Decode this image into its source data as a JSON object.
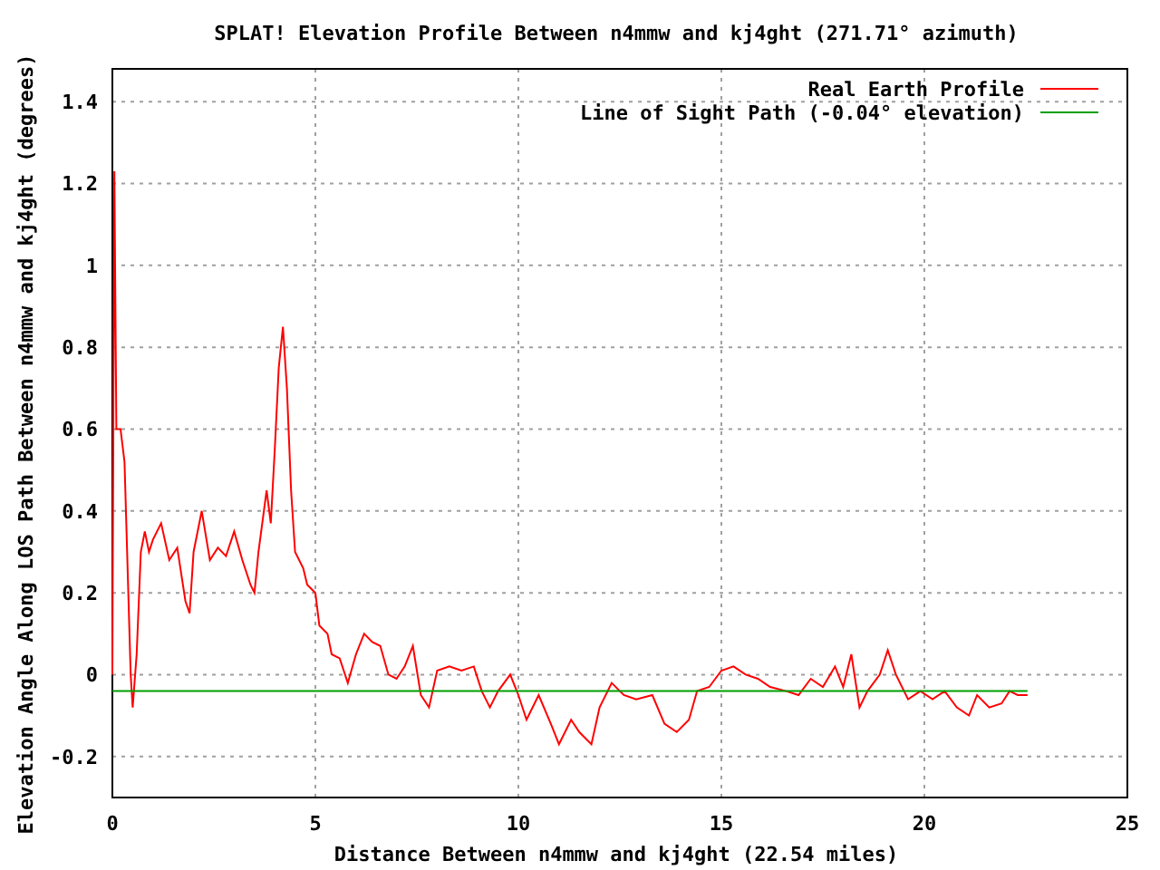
{
  "chart": {
    "chart_data": {
      "type": "line",
      "title": "SPLAT! Elevation Profile Between n4mmw and kj4ght (271.71° azimuth)",
      "xlabel": "Distance Between n4mmw and kj4ght (22.54 miles)",
      "ylabel": "Elevation Angle Along LOS Path Between n4mmw and kj4ght (degrees)",
      "xlim": [
        0,
        25
      ],
      "ylim": [
        -0.3,
        1.48
      ],
      "grid": true,
      "legend": "upper right",
      "xticks": [
        0,
        5,
        10,
        15,
        20,
        25
      ],
      "yticks": [
        -0.2,
        0,
        0.2,
        0.4,
        0.6,
        0.8,
        1,
        1.2,
        1.4
      ],
      "x": [
        0,
        0.05,
        0.1,
        0.2,
        0.3,
        0.45,
        0.5,
        0.6,
        0.7,
        0.8,
        0.9,
        1.0,
        1.2,
        1.4,
        1.6,
        1.8,
        1.9,
        2.0,
        2.2,
        2.4,
        2.6,
        2.8,
        3.0,
        3.2,
        3.4,
        3.5,
        3.6,
        3.8,
        3.9,
        4.0,
        4.1,
        4.2,
        4.3,
        4.4,
        4.5,
        4.7,
        4.8,
        5.0,
        5.1,
        5.3,
        5.4,
        5.6,
        5.8,
        6.0,
        6.2,
        6.4,
        6.6,
        6.8,
        7.0,
        7.2,
        7.4,
        7.6,
        7.8,
        8.0,
        8.3,
        8.6,
        8.9,
        9.1,
        9.3,
        9.5,
        9.8,
        10.0,
        10.2,
        10.5,
        10.8,
        11.0,
        11.3,
        11.5,
        11.8,
        12.0,
        12.3,
        12.6,
        12.9,
        13.3,
        13.6,
        13.9,
        14.2,
        14.4,
        14.7,
        15.0,
        15.3,
        15.6,
        15.9,
        16.2,
        16.6,
        16.9,
        17.2,
        17.5,
        17.8,
        18.0,
        18.2,
        18.4,
        18.6,
        18.9,
        19.1,
        19.3,
        19.6,
        19.9,
        20.2,
        20.5,
        20.8,
        21.1,
        21.3,
        21.6,
        21.9,
        22.1,
        22.3,
        22.54
      ],
      "series": [
        {
          "name": "Real Earth Profile",
          "color": "#ff0000",
          "values": [
            0,
            1.23,
            0.6,
            0.6,
            0.52,
            0.0,
            -0.08,
            0.05,
            0.3,
            0.35,
            0.3,
            0.33,
            0.37,
            0.28,
            0.31,
            0.18,
            0.15,
            0.3,
            0.4,
            0.28,
            0.31,
            0.29,
            0.35,
            0.28,
            0.22,
            0.2,
            0.3,
            0.45,
            0.37,
            0.55,
            0.75,
            0.85,
            0.7,
            0.45,
            0.3,
            0.26,
            0.22,
            0.2,
            0.12,
            0.1,
            0.05,
            0.04,
            -0.02,
            0.05,
            0.1,
            0.08,
            0.07,
            0.0,
            -0.01,
            0.02,
            0.07,
            -0.05,
            -0.08,
            0.01,
            0.02,
            0.01,
            0.02,
            -0.04,
            -0.08,
            -0.04,
            0.0,
            -0.05,
            -0.11,
            -0.05,
            -0.12,
            -0.17,
            -0.11,
            -0.14,
            -0.17,
            -0.08,
            -0.02,
            -0.05,
            -0.06,
            -0.05,
            -0.12,
            -0.14,
            -0.11,
            -0.04,
            -0.03,
            0.01,
            0.02,
            0.0,
            -0.01,
            -0.03,
            -0.04,
            -0.05,
            -0.01,
            -0.03,
            0.02,
            -0.03,
            0.05,
            -0.08,
            -0.04,
            0.0,
            0.06,
            0.0,
            -0.06,
            -0.04,
            -0.06,
            -0.04,
            -0.08,
            -0.1,
            -0.05,
            -0.08,
            -0.07,
            -0.04,
            -0.05,
            -0.05
          ]
        },
        {
          "name": "Line of Sight Path (-0.04° elevation)",
          "color": "#00a000",
          "values": [
            -0.04,
            -0.04,
            -0.04,
            -0.04,
            -0.04,
            -0.04,
            -0.04,
            -0.04,
            -0.04,
            -0.04,
            -0.04,
            -0.04,
            -0.04,
            -0.04,
            -0.04,
            -0.04,
            -0.04,
            -0.04,
            -0.04,
            -0.04,
            -0.04,
            -0.04,
            -0.04,
            -0.04,
            -0.04,
            -0.04,
            -0.04,
            -0.04,
            -0.04,
            -0.04,
            -0.04,
            -0.04,
            -0.04,
            -0.04,
            -0.04,
            -0.04,
            -0.04,
            -0.04,
            -0.04,
            -0.04,
            -0.04,
            -0.04,
            -0.04,
            -0.04,
            -0.04,
            -0.04,
            -0.04,
            -0.04,
            -0.04,
            -0.04,
            -0.04,
            -0.04,
            -0.04,
            -0.04,
            -0.04,
            -0.04,
            -0.04,
            -0.04,
            -0.04,
            -0.04,
            -0.04,
            -0.04,
            -0.04,
            -0.04,
            -0.04,
            -0.04,
            -0.04,
            -0.04,
            -0.04,
            -0.04,
            -0.04,
            -0.04,
            -0.04,
            -0.04,
            -0.04,
            -0.04,
            -0.04,
            -0.04,
            -0.04,
            -0.04,
            -0.04,
            -0.04,
            -0.04,
            -0.04,
            -0.04,
            -0.04,
            -0.04,
            -0.04,
            -0.04,
            -0.04,
            -0.04,
            -0.04,
            -0.04,
            -0.04,
            -0.04,
            -0.04,
            -0.04,
            -0.04,
            -0.04,
            -0.04,
            -0.04,
            -0.04,
            -0.04,
            -0.04,
            -0.04,
            -0.04,
            -0.04,
            -0.04
          ]
        }
      ]
    }
  }
}
